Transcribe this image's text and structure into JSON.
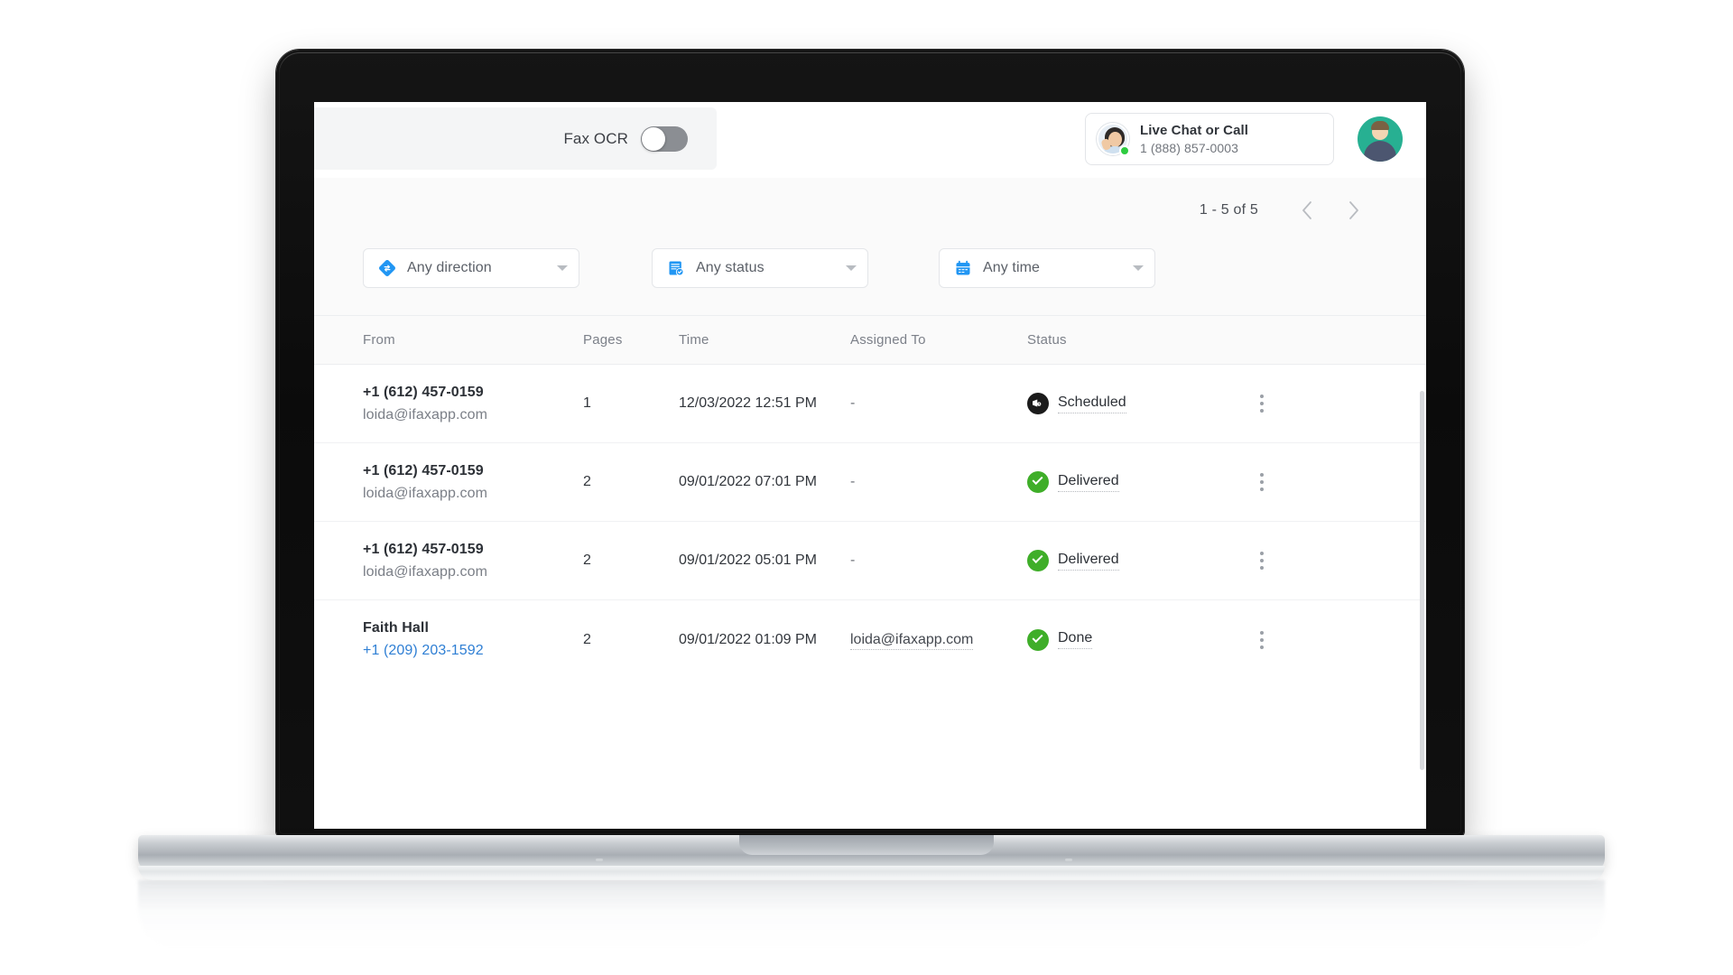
{
  "topbar": {
    "ocr_label": "Fax OCR",
    "ocr_toggle_state": "off",
    "chat": {
      "title": "Live Chat or Call",
      "phone": "1 (888) 857-0003",
      "presence": "online"
    }
  },
  "pagination": {
    "range_label": "1 - 5 of 5",
    "prev_icon": "chevron-left-icon",
    "next_icon": "chevron-right-icon"
  },
  "filters": [
    {
      "label": "Any direction",
      "icon": "direction-diamond-icon",
      "icon_color": "#2196f3"
    },
    {
      "label": "Any status",
      "icon": "status-document-icon",
      "icon_color": "#2196f3"
    },
    {
      "label": "Any time",
      "icon": "calendar-icon",
      "icon_color": "#2196f3"
    }
  ],
  "table": {
    "columns": [
      "From",
      "Pages",
      "Time",
      "Assigned To",
      "Status"
    ],
    "rows": [
      {
        "from_main": "+1 (612) 457-0159",
        "from_sub": "loida@ifaxapp.com",
        "from_sub_is_link": false,
        "pages": "1",
        "time": "12/03/2022 12:51 PM",
        "assigned_to": "-",
        "assigned_is_link": false,
        "status": "Scheduled",
        "status_type": "scheduled",
        "status_color": "#1b1b1b"
      },
      {
        "from_main": "+1 (612) 457-0159",
        "from_sub": "loida@ifaxapp.com",
        "from_sub_is_link": false,
        "pages": "2",
        "time": "09/01/2022 07:01 PM",
        "assigned_to": "-",
        "assigned_is_link": false,
        "status": "Delivered",
        "status_type": "delivered",
        "status_color": "#3fae29"
      },
      {
        "from_main": "+1 (612) 457-0159",
        "from_sub": "loida@ifaxapp.com",
        "from_sub_is_link": false,
        "pages": "2",
        "time": "09/01/2022 05:01 PM",
        "assigned_to": "-",
        "assigned_is_link": false,
        "status": "Delivered",
        "status_type": "delivered",
        "status_color": "#3fae29"
      },
      {
        "from_main": "Faith Hall",
        "from_sub": "+1 (209) 203-1592",
        "from_sub_is_link": true,
        "pages": "2",
        "time": "09/01/2022 01:09 PM",
        "assigned_to": "loida@ifaxapp.com",
        "assigned_is_link": true,
        "status": "Done",
        "status_type": "done",
        "status_color": "#3fae29"
      }
    ],
    "row_menu_icon": "kebab-menu-icon"
  },
  "colors": {
    "accent_blue": "#2196f3",
    "status_green": "#3fae29",
    "status_dark": "#1b1b1b",
    "presence_green": "#2ecc40",
    "avatar_green": "#27b092"
  }
}
